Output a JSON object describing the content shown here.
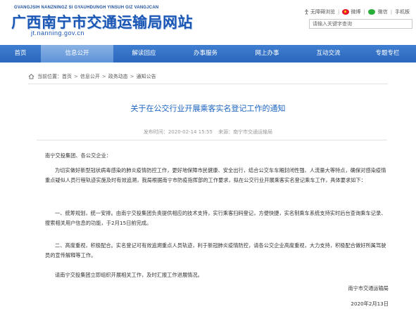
{
  "header": {
    "pinyin": "GVANGJSIH NANZNINGZ SI GYAUHDUNGH YINSUH GIZ VANGJCAN",
    "title": "广西南宁市交通运输局网站",
    "url": "jt.nanning.gov.cn",
    "links": {
      "barrier_free": "无障碍浏览",
      "weibo": "微博",
      "wechat": "微信",
      "mobile": "手机板"
    },
    "search_placeholder": "请输入关键字查询"
  },
  "nav": {
    "items": [
      "首页",
      "信息公开",
      "解读回应",
      "办事服务",
      "网上办事",
      "互动交流",
      "专题专栏"
    ],
    "active_index": 1
  },
  "breadcrumb": {
    "label": "当前位置：",
    "items": [
      "首页",
      "信息公开",
      "政务动态",
      "通知公告"
    ]
  },
  "article": {
    "title": "关于在公交行业开展乘客实名登记工作的通知",
    "publish_label": "发布时间：",
    "publish_time": "2020-02-14 15:55",
    "source_label": "来源：",
    "source": "南宁市交通运输局",
    "salutation": "南宁交投集团、各公交企业：",
    "p1": "为切实做好新型冠状病毒感染的肺炎疫情防控工作，更好地保障市民健康、安全出行，结合公交车车厢封闭性强、人流量大等特点，确保对感染疫情重点疑似人员行程轨迹实施及时有效追溯，我局根据南宁市防疫指挥部的工作要求，拟在公交行业开展乘客实名登记乘车工作，具体要求如下：",
    "p2": "一、统筹规划，统一安排。由南宁交投集团负责提供相应的技术支持，实行乘客扫码登记，方便快捷，实名制乘车系统支持实时后台查询乘车记录、搜索相关用户信息的功能，于2月15日前完成。",
    "p3": "二、高度重视，积极配合。实名登记可有效追溯重点人员轨迹，利于新冠肺炎疫情防控，请各公交企业高度重视，大力支持，积极配合做好所属驾驶员的宣传解释等工作。",
    "p4": "请南宁交投集团立即组织开展相关工作，及时汇报工作进展情况。",
    "signature": "南宁市交通运输局",
    "date": "2020年2月13日"
  },
  "colors": {
    "brand_blue": "#1a57b5",
    "nav_blue": "#2b67bd",
    "nav_active": "#6c9fdc",
    "title_blue": "#1c64c1"
  }
}
